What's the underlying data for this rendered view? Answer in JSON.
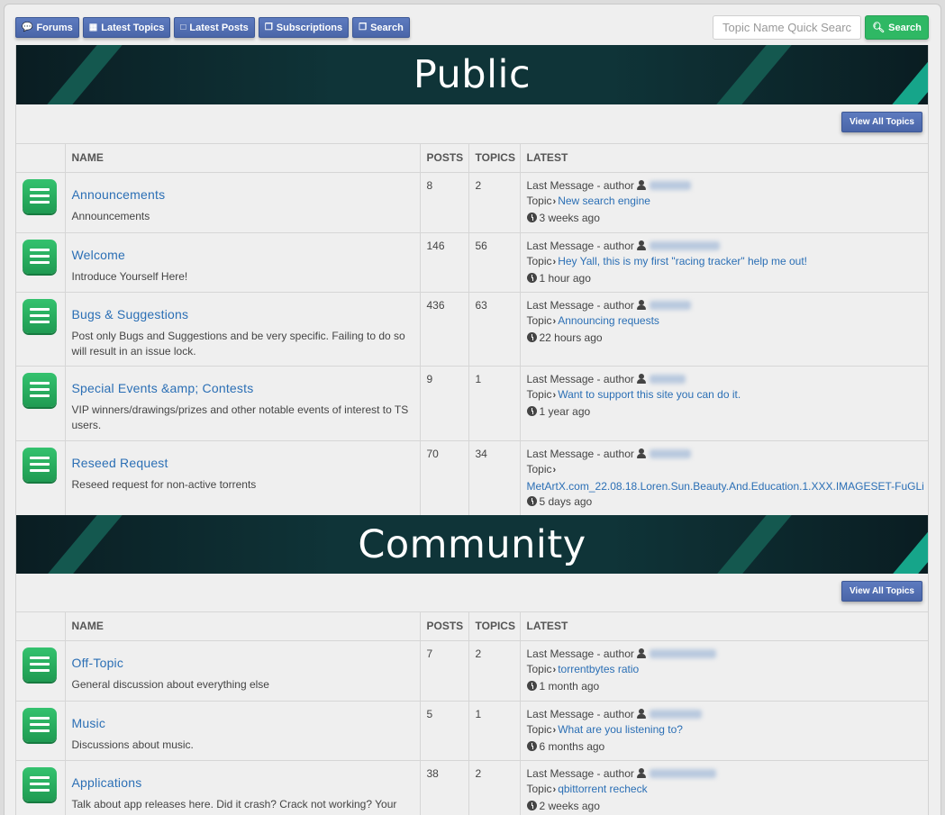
{
  "nav": {
    "items": [
      {
        "label": "Forums",
        "icon": "comments-icon"
      },
      {
        "label": "Latest Topics",
        "icon": "book-icon"
      },
      {
        "label": "Latest Posts",
        "icon": "file-icon"
      },
      {
        "label": "Subscriptions",
        "icon": "copy-icon"
      },
      {
        "label": "Search",
        "icon": "copy-icon"
      }
    ],
    "search_placeholder": "Topic Name Quick Search",
    "search_button": "Search"
  },
  "columns": {
    "name": "NAME",
    "posts": "POSTS",
    "topics": "TOPICS",
    "latest": "LATEST"
  },
  "latest_labels": {
    "last_message": "Last Message - author",
    "topic": "Topic"
  },
  "categories": [
    {
      "title": "Public",
      "view_all": "View All Topics",
      "forums": [
        {
          "name": "Announcements",
          "desc": "Announcements",
          "posts": "8",
          "topics": "2",
          "topic": "New search engine",
          "ago": "3 weeks ago"
        },
        {
          "name": "Welcome",
          "desc": "Introduce Yourself Here!",
          "posts": "146",
          "topics": "56",
          "topic": "Hey Yall, this is my first \"racing tracker\" help me out!",
          "ago": "1 hour ago"
        },
        {
          "name": "Bugs & Suggestions",
          "desc": "Post only Bugs and Suggestions and be very specific. Failing to do so will result in an issue lock.",
          "posts": "436",
          "topics": "63",
          "topic": "Announcing requests",
          "ago": "22 hours ago"
        },
        {
          "name": "Special Events &amp; Contests",
          "desc": "VIP winners/drawings/prizes and other notable events of interest to TS users.",
          "posts": "9",
          "topics": "1",
          "topic": "Want to support this site you can do it.",
          "ago": "1 year ago"
        },
        {
          "name": "Reseed Request",
          "desc": "Reseed request for non-active torrents",
          "posts": "70",
          "topics": "34",
          "topic": "MetArtX.com_22.08.18.Loren.Sun.Beauty.And.Education.1.XXX.IMAGESET-FuGLi",
          "ago": "5 days ago"
        }
      ]
    },
    {
      "title": "Community",
      "view_all": "View All Topics",
      "forums": [
        {
          "name": "Off-Topic",
          "desc": "General discussion about everything else",
          "posts": "7",
          "topics": "2",
          "topic": "torrentbytes ratio",
          "ago": "1 month ago"
        },
        {
          "name": "Music",
          "desc": "Discussions about music.",
          "posts": "5",
          "topics": "1",
          "topic": "What are you listening to?",
          "ago": "6 months ago"
        },
        {
          "name": "Applications",
          "desc": "Talk about app releases here. Did it crash? Crack not working? Your",
          "posts": "38",
          "topics": "2",
          "topic": "qbittorrent recheck",
          "ago": "2 weeks ago"
        }
      ]
    }
  ],
  "colors": {
    "nav_button": "#4a66a8",
    "search_button": "#2fb864",
    "link": "#2b6fb5",
    "banner": "#0f3438",
    "accent_stripe": "#16a58a"
  }
}
